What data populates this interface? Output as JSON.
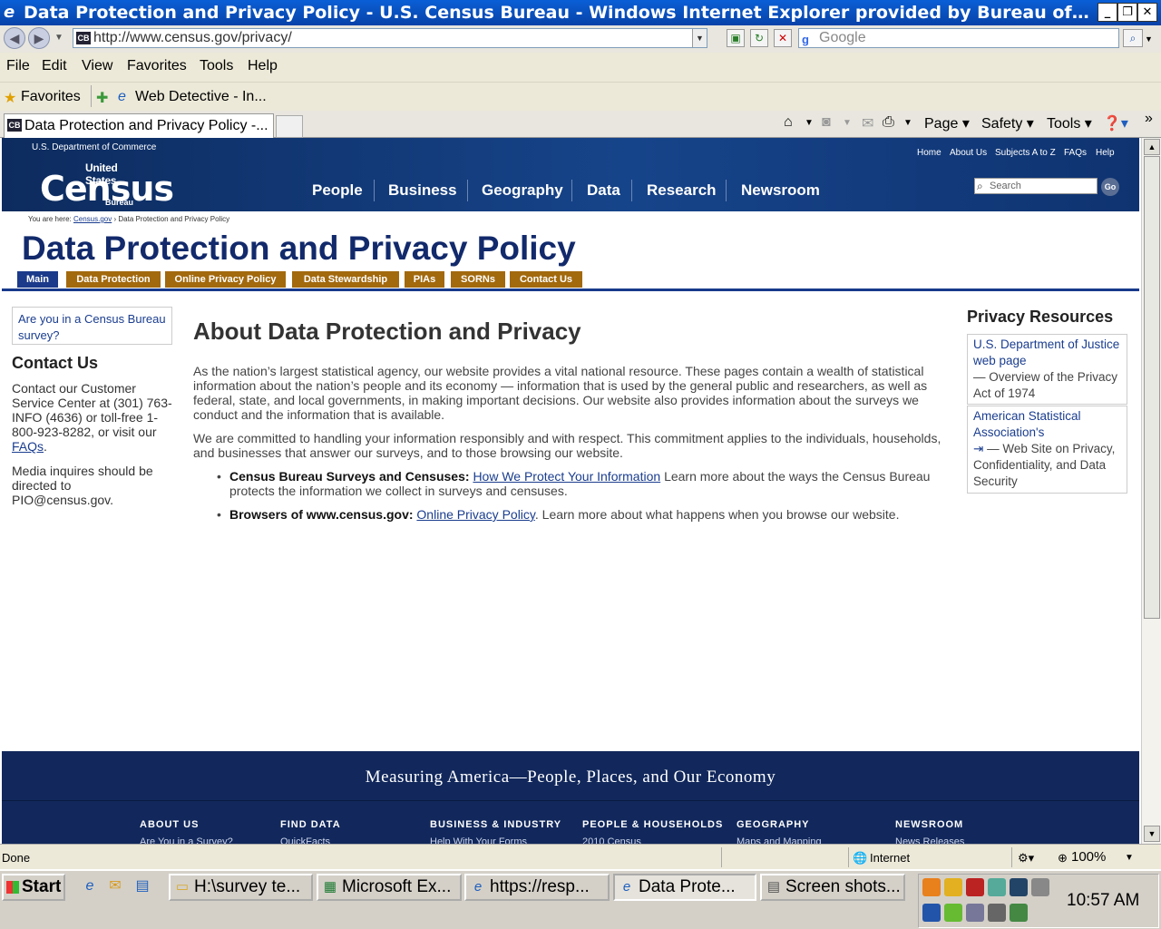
{
  "window": {
    "title": "Data Protection and Privacy Policy - U.S. Census Bureau - Windows Internet Explorer provided by Bureau of Labor Statistics",
    "title_display": "Data Protection and Privacy Policy - U.S. Census Bureau - Windows Internet Explorer provided by Bureau of Labor Statist...",
    "min": "_",
    "restore": "❐",
    "close": "✕"
  },
  "address": {
    "url": "http://www.census.gov/privacy/",
    "favicon": "CB",
    "search_placeholder": "Google"
  },
  "menu": [
    "File",
    "Edit",
    "View",
    "Favorites",
    "Tools",
    "Help"
  ],
  "favorites": {
    "label": "Favorites",
    "item": "Web Detective - In..."
  },
  "tab": {
    "label": "Data Protection and Privacy Policy -...",
    "favicon": "CB"
  },
  "commands": {
    "page": "Page",
    "safety": "Safety",
    "tools": "Tools"
  },
  "census": {
    "dept": "U.S. Department of Commerce",
    "logo_us": "United States",
    "logo_census": "Census",
    "logo_bureau": "Bureau",
    "toplinks": [
      "Home",
      "About Us",
      "Subjects A to Z",
      "FAQs",
      "Help"
    ],
    "nav": [
      "People",
      "Business",
      "Geography",
      "Data",
      "Research",
      "Newsroom"
    ],
    "search_placeholder": "Search",
    "search_go": "Go",
    "breadcrumb_prefix": "You are here:",
    "breadcrumb_link": "Census.gov",
    "breadcrumb_current": "Data Protection and Privacy Policy",
    "page_title": "Data Protection and Privacy Policy",
    "subtabs": [
      "Main",
      "Data Protection",
      "Online Privacy Policy",
      "Data Stewardship",
      "PIAs",
      "SORNs",
      "Contact Us"
    ]
  },
  "left": {
    "survey_link": "Are you in a Census Bureau survey?",
    "contact_heading": "Contact Us",
    "contact_text": "Contact our Customer Service Center at (301) 763-INFO (4636) or toll-free 1-800-923-8282, or visit our",
    "contact_link": "FAQs",
    "media_text": "Media inquires should be directed to PIO@census.gov."
  },
  "main": {
    "heading": "About Data Protection and Privacy",
    "para1": "As the nation’s largest statistical agency, our website provides a vital national resource. These pages contain a wealth of statistical information about the nation’s people and its economy — information that is used by the general public and researchers, as well as federal, state, and local governments, in making important decisions. Our website also provides information about the surveys we conduct and the information that is available.",
    "para2": "We are committed to handling your information responsibly and with respect. This commitment applies to the individuals, households, and businesses that answer our surveys, and to those browsing our website.",
    "bullet1_label": "Census Bureau Surveys and Censuses:",
    "bullet1_link": "How We Protect Your Information",
    "bullet1_text": "Learn more about the ways the Census Bureau protects the information we collect in surveys and censuses.",
    "bullet2_label": "Browsers of www.census.gov:",
    "bullet2_link": "Online Privacy Policy",
    "bullet2_text": ". Learn more about what happens when you browse our website."
  },
  "right": {
    "heading": "Privacy Resources",
    "res1_link": "U.S. Department of Justice web page",
    "res1_text": "— Overview of the Privacy Act of 1974",
    "res2_link": "American Statistical Association's",
    "res2_text": "— Web Site on Privacy, Confidentiality, and Data Security"
  },
  "footer": {
    "tagline": "Measuring America—People, Places, and Our Economy",
    "cols": [
      "ABOUT US",
      "FIND DATA",
      "BUSINESS & INDUSTRY",
      "PEOPLE & HOUSEHOLDS",
      "GEOGRAPHY",
      "NEWSROOM"
    ],
    "subs": [
      "Are You in a Survey?",
      "QuickFacts",
      "Help With Your Forms",
      "2010 Census",
      "Maps and Mapping",
      "News Releases"
    ]
  },
  "status": {
    "text": "Done",
    "zone": "Internet",
    "zoom": "100%"
  },
  "taskbar": {
    "start": "Start",
    "tasks": [
      "H:\\survey te...",
      "Microsoft Ex...",
      "https://resp...",
      "Data Prote...",
      "Screen shots..."
    ],
    "clock": "10:57 AM"
  }
}
